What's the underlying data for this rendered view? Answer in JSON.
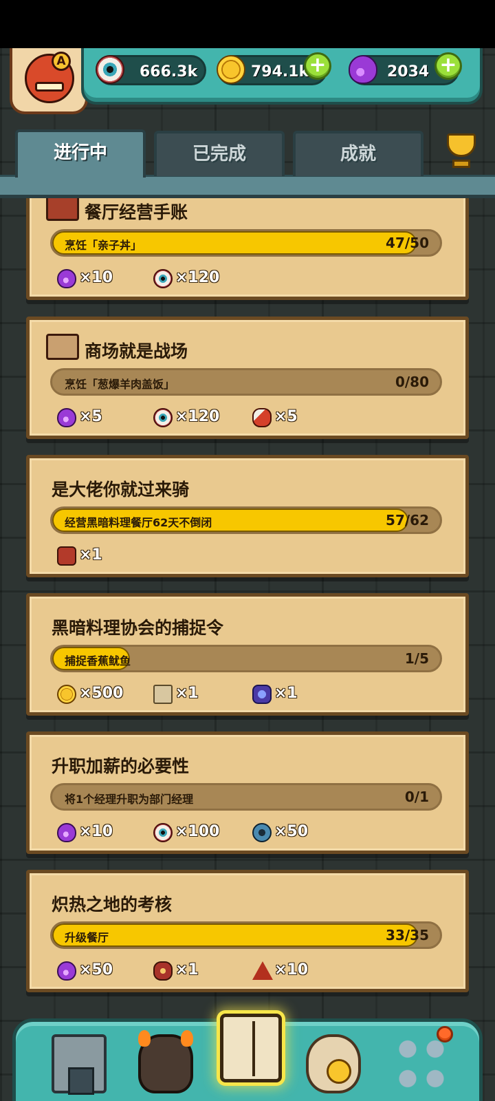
{
  "header": {
    "avatar_badge": "A",
    "resources": [
      {
        "icon": "eyeball-icon",
        "value": "666.3k",
        "has_add": false
      },
      {
        "icon": "coin-icon",
        "value": "794.1k",
        "has_add": true
      },
      {
        "icon": "potion-icon",
        "value": "2034",
        "has_add": true
      }
    ],
    "add_symbol": "+"
  },
  "tabs": [
    {
      "label": "进行中",
      "active": true
    },
    {
      "label": "已完成",
      "active": false
    },
    {
      "label": "成就",
      "active": false
    }
  ],
  "quests": [
    {
      "title": "餐厅经营手账",
      "title_icon": "journal-icon",
      "task": "烹饪「亲子丼」",
      "progress_text": "47/50",
      "progress": 0.94,
      "rewards": [
        {
          "icon": "potion-icon",
          "qty": "×10"
        },
        {
          "icon": "eyeball-icon",
          "qty": "×120"
        }
      ]
    },
    {
      "title": "商场就是战场",
      "title_icon": "map-scroll-icon",
      "task": "烹饪「葱爆羊肉盖饭」",
      "progress_text": "0/80",
      "progress": 0,
      "rewards": [
        {
          "icon": "potion-icon",
          "qty": "×5"
        },
        {
          "icon": "eyeball-icon",
          "qty": "×120"
        },
        {
          "icon": "meat-icon",
          "qty": "×5"
        }
      ]
    },
    {
      "title": "是大佬你就过来骑",
      "title_icon": null,
      "task": "经营黑暗料理餐厅62天不倒闭",
      "progress_text": "57/62",
      "progress": 0.919,
      "rewards": [
        {
          "icon": "monster-mount-icon",
          "qty": "×1"
        }
      ]
    },
    {
      "title": "黑暗料理协会的捕捉令",
      "title_icon": null,
      "task": "捕捉香蕉鱿鱼",
      "progress_text": "1/5",
      "progress": 0.2,
      "rewards": [
        {
          "icon": "coin-icon",
          "qty": "×500"
        },
        {
          "icon": "map-icon",
          "qty": "×1"
        },
        {
          "icon": "crystal-icon",
          "qty": "×1"
        }
      ]
    },
    {
      "title": "升职加薪的必要性",
      "title_icon": null,
      "task": "将1个经理升职为部门经理",
      "progress_text": "0/1",
      "progress": 0,
      "rewards": [
        {
          "icon": "potion-icon",
          "qty": "×10"
        },
        {
          "icon": "eyeball-icon",
          "qty": "×100"
        },
        {
          "icon": "gear-icon",
          "qty": "×50"
        }
      ]
    },
    {
      "title": "炽热之地的考核",
      "title_icon": null,
      "task": "升级餐厅",
      "progress_text": "33/35",
      "progress": 0.943,
      "rewards": [
        {
          "icon": "potion-icon",
          "qty": "×50"
        },
        {
          "icon": "flower-icon",
          "qty": "×1"
        },
        {
          "icon": "fire-crystal-icon",
          "qty": "×10"
        }
      ]
    }
  ],
  "bottom_nav": [
    {
      "name": "nav-restaurant",
      "icon": "restaurant-icon",
      "active": false
    },
    {
      "name": "nav-monster",
      "icon": "monster-icon",
      "active": false
    },
    {
      "name": "nav-quest-book",
      "icon": "book-icon",
      "active": true
    },
    {
      "name": "nav-bag",
      "icon": "money-bag-icon",
      "active": false
    },
    {
      "name": "nav-more",
      "icon": "grid-menu-icon",
      "active": false,
      "notification": true
    }
  ],
  "colors": {
    "teal": "#43b5ad",
    "progress_fill": "#f7c700",
    "parchment": "#e9c98f"
  }
}
